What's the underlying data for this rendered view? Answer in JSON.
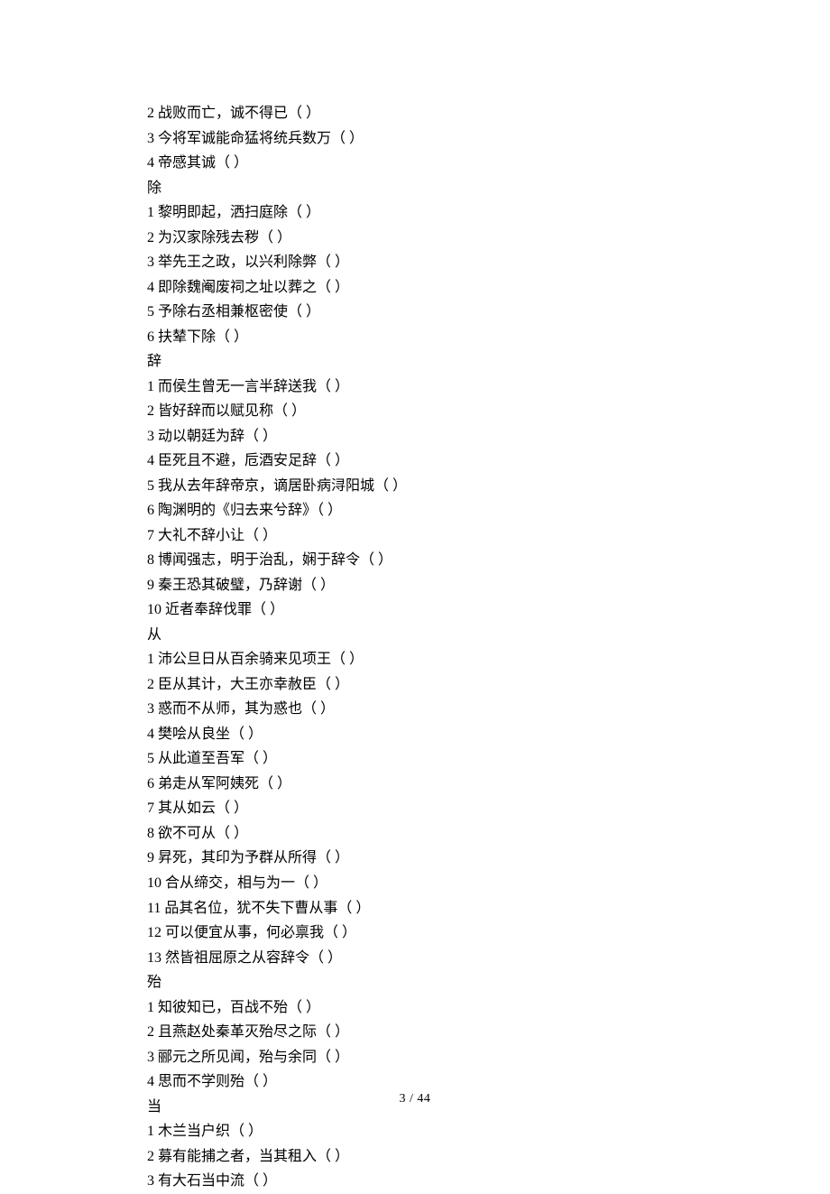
{
  "lines": [
    "2 战败而亡，诚不得已（ ）",
    "3 今将军诚能命猛将统兵数万（ ）",
    "4 帝感其诚（ ）",
    "除",
    "1 黎明即起，洒扫庭除（ ）",
    "2 为汉家除残去秽（ ）",
    "3 举先王之政，以兴利除弊（ ）",
    "4 即除魏阉废祠之址以葬之（ ）",
    "5 予除右丞相兼枢密使（ ）",
    "6 扶辇下除（ ）",
    "辞",
    "1 而侯生曾无一言半辞送我（ ）",
    "2 皆好辞而以赋见称（ ）",
    "3 动以朝廷为辞（ ）",
    "4 臣死且不避，卮酒安足辞（ ）",
    "5 我从去年辞帝京，谪居卧病浔阳城（ ）",
    "6 陶渊明的《归去来兮辞》（ ）",
    "7 大礼不辞小让（ ）",
    "8 博闻强志，明于治乱，娴于辞令（ ）",
    "9 秦王恐其破璧，乃辞谢（ ）",
    "10 近者奉辞伐罪（ ）",
    "从",
    "1 沛公旦日从百余骑来见项王（ ）",
    "2 臣从其计，大王亦幸赦臣（ ）",
    "3 惑而不从师，其为惑也（ ）",
    "4 樊哙从良坐（ ）",
    "5 从此道至吾军（ ）",
    "6 弟走从军阿姨死（ ）",
    "7 其从如云（ ）",
    "8 欲不可从（ ）",
    "9 昇死，其印为予群从所得（ ）",
    "10 合从缔交，相与为一（ ）",
    "11 品其名位，犹不失下曹从事（ ）",
    "12 可以便宜从事，何必禀我（ ）",
    "13 然皆祖屈原之从容辞令（ ）",
    "殆",
    "1 知彼知已，百战不殆（ ）",
    "2 且燕赵处秦革灭殆尽之际（ ）",
    "3 郦元之所见闻，殆与余同（ ）",
    "4 思而不学则殆（ ）",
    "当",
    "1 木兰当户织（ ）",
    "2 募有能捕之者，当其租入（ ）",
    "3 有大石当中流（ ）"
  ],
  "footer": "3  /  44"
}
